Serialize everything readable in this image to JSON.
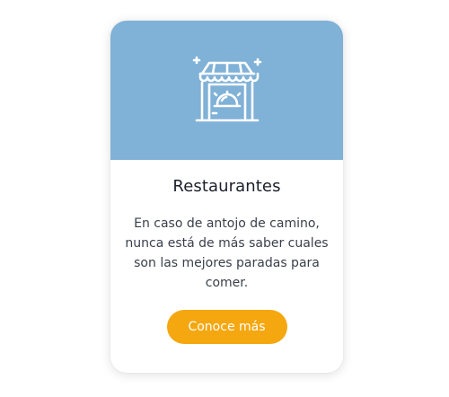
{
  "card": {
    "icon": "restaurant-storefront-icon",
    "banner_color": "#80b1d7",
    "title": "Restaurantes",
    "description": "En caso de antojo de camino, nunca está de más saber cuales son las mejores paradas para comer.",
    "button_label": "Conoce más",
    "button_color": "#f5a70f"
  }
}
